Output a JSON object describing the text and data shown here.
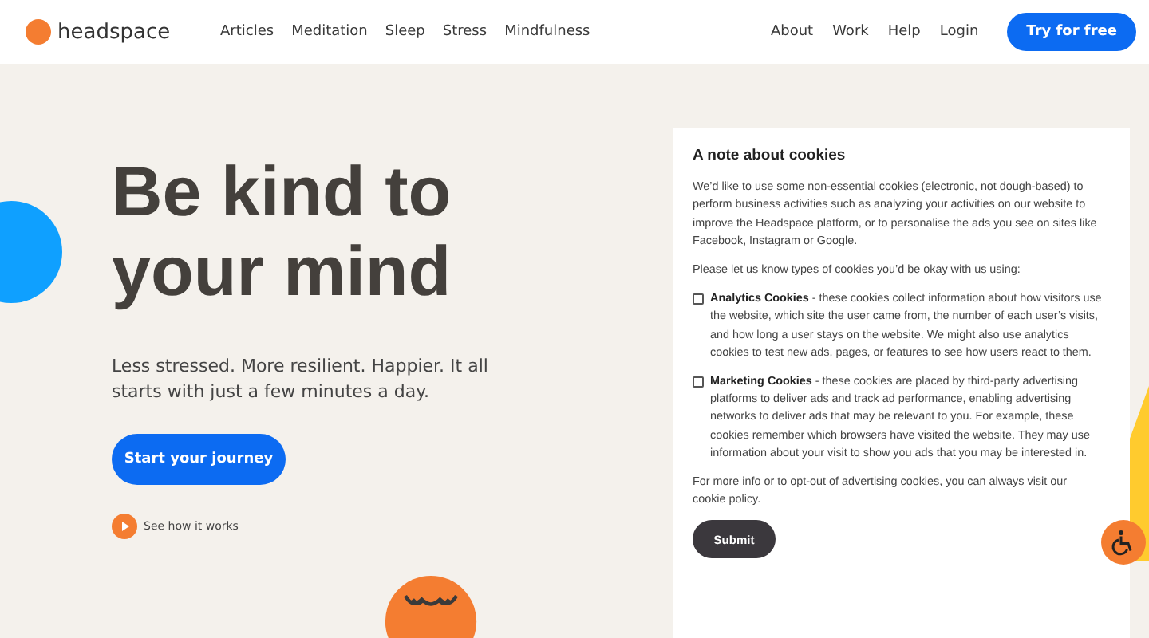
{
  "header": {
    "logo": "headspace",
    "nav": [
      "Articles",
      "Meditation",
      "Sleep",
      "Stress",
      "Mindfulness"
    ],
    "links": [
      "About",
      "Work",
      "Help",
      "Login"
    ],
    "cta": "Try for free"
  },
  "hero": {
    "title": "Be kind to your mind",
    "subtitle": "Less stressed. More resilient. Happier. It all starts with just a few minutes a day.",
    "button": "Start your journey",
    "video_link": "See how it works"
  },
  "cookie_dialog": {
    "title": "A note about cookies",
    "intro": "We’d like to use some non-essential cookies (electronic, not dough-based) to perform business activities such as analyzing your activities on our website to improve the Headspace platform, or to personalise the ads you see on sites like Facebook, Instagram or Google.",
    "prompt": "Please let us know types of cookies you’d be okay with us using:",
    "options": [
      {
        "text": "**Analytics Cookies** - these cookies collect information about how visitors use the website, which site the user came from, the number of each user’s visits, and how long a user stays on the website. We might also use analytics cookies to test new ads, pages, or features to see how users react to them.",
        "checked": false
      },
      {
        "text": "**Marketing Cookies** - these cookies are placed by third-party advertising platforms to deliver ads and track ad performance, enabling advertising networks to deliver ads that may be relevant to you. For example, these cookies remember which browsers have visited the website. They may use information about your visit to show you ads that you may be interested in.",
        "checked": false
      }
    ],
    "footer": "For more info or to opt-out of advertising cookies, you can always visit our",
    "policy_link": "cookie policy.",
    "submit": "Submit"
  }
}
